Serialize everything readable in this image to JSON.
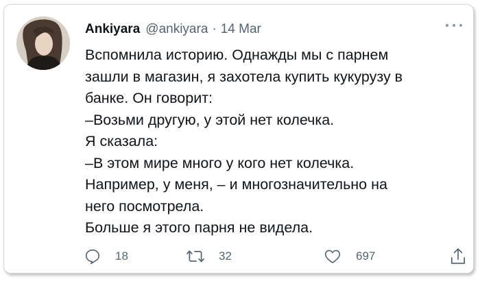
{
  "tweet": {
    "display_name": "Ankiyara",
    "handle": "@ankiyara",
    "separator": "·",
    "date": "14 Mar",
    "lines": [
      "Вспомнила историю. Однажды мы с парнем",
      "зашли в магазин, я захотела купить кукурузу в",
      "банке. Он говорит:",
      "–Возьми другую, у этой нет колечка.",
      "Я сказала:",
      "–В этом мире много у кого нет колечка.",
      "Например, у меня, – и многозначительно на",
      "него посмотрела.",
      "Больше я этого парня не видела."
    ],
    "actions": {
      "replies": "18",
      "retweets": "32",
      "likes": "697"
    }
  },
  "icons": {
    "avatar": "profile-photo",
    "more": "more-dots-icon",
    "reply": "reply-icon",
    "retweet": "retweet-icon",
    "like": "heart-icon",
    "share": "share-icon"
  },
  "colors": {
    "text": "#0f1419",
    "secondary": "#536471",
    "border": "#d6d6d6"
  }
}
